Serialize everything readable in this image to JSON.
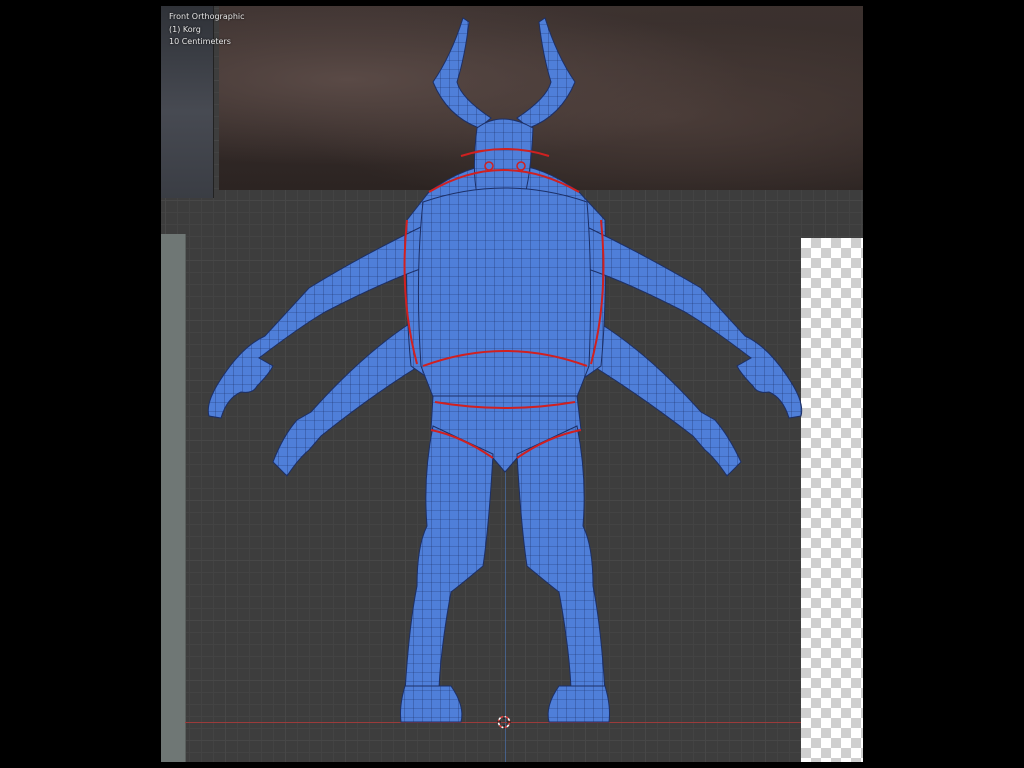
{
  "viewport": {
    "view_name": "Front Orthographic",
    "object_name": "(1) Korg",
    "grid_scale": "10 Centimeters"
  },
  "icons": {
    "cursor": "3d-cursor-icon"
  },
  "colors": {
    "mesh_fill": "#4f7fd9",
    "mesh_wire": "#1c2f66",
    "seam": "#d02020",
    "background": "#3d3d3d"
  }
}
